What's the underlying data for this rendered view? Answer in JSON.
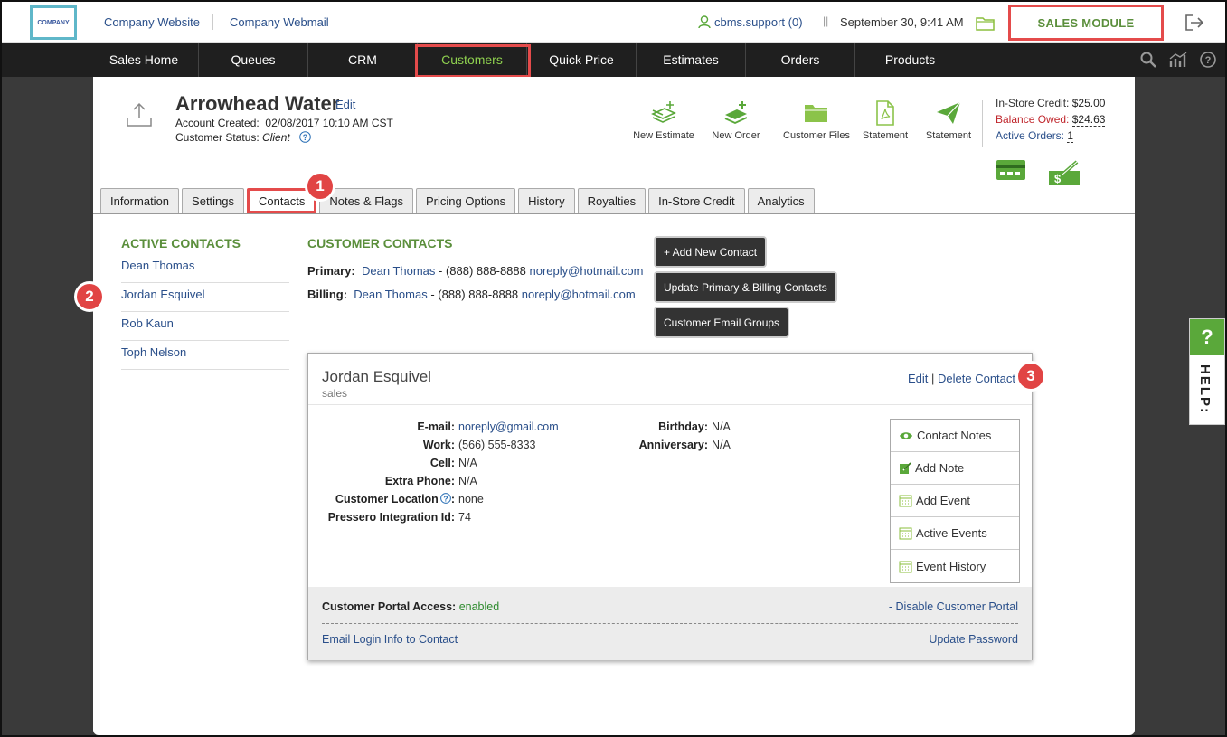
{
  "topbar": {
    "logo_text": "COMPANY",
    "company_website": "Company Website",
    "company_webmail": "Company Webmail",
    "user": "cbms.support (0)",
    "pipes": "||",
    "date": "September 30, 9:41 AM",
    "module": "SALES MODULE"
  },
  "nav": {
    "items": [
      "Sales Home",
      "Queues",
      "CRM",
      "Customers",
      "Quick Price",
      "Estimates",
      "Orders",
      "Products"
    ],
    "active": "Customers"
  },
  "customer": {
    "name": "Arrowhead Water",
    "edit": "Edit",
    "created_label": "Account Created:",
    "created_value": "02/08/2017 10:10 AM CST",
    "status_label": "Customer Status:",
    "status_value": "Client"
  },
  "quick_actions": [
    "New Estimate",
    "New Order",
    "Customer Files",
    "Statement",
    "Statement"
  ],
  "credit": {
    "instore_label": "In-Store Credit:",
    "instore_value": "$25.00",
    "owed_label": "Balance Owed:",
    "owed_value": "$24.63",
    "orders_label": "Active Orders:",
    "orders_value": "1"
  },
  "tabs": [
    "Information",
    "Settings",
    "Contacts",
    "Notes & Flags",
    "Pricing Options",
    "History",
    "Royalties",
    "In-Store Credit",
    "Analytics"
  ],
  "active_tab": "Contacts",
  "badges": [
    "1",
    "2",
    "3"
  ],
  "active_contacts": {
    "title": "ACTIVE CONTACTS",
    "items": [
      "Dean Thomas",
      "Jordan Esquivel",
      "Rob Kaun",
      "Toph Nelson"
    ]
  },
  "customer_contacts": {
    "title": "CUSTOMER CONTACTS",
    "primary_label": "Primary:",
    "primary_name": "Dean Thomas",
    "primary_phone": " - (888) 888-8888 ",
    "primary_email": "noreply@hotmail.com",
    "billing_label": "Billing:",
    "billing_name": "Dean Thomas",
    "billing_phone": " - (888) 888-8888 ",
    "billing_email": "noreply@hotmail.com"
  },
  "buttons": {
    "add_contact": "+ Add New Contact",
    "update_primary": "Update Primary & Billing Contacts",
    "email_groups": "Customer Email Groups"
  },
  "contact_card": {
    "name": "Jordan Esquivel",
    "title": "sales",
    "edit": "Edit",
    "sep": " | ",
    "delete": "Delete Contact",
    "fields": [
      {
        "label": "E-mail:",
        "value": "noreply@gmail.com"
      },
      {
        "label": "Work:",
        "value": "(566) 555-8333"
      },
      {
        "label": "Cell:",
        "value": "N/A"
      },
      {
        "label": "Extra Phone:",
        "value": "N/A"
      },
      {
        "label": "Customer Location",
        "value": "none"
      },
      {
        "label": "Pressero Integration Id:",
        "value": "74"
      }
    ],
    "fields2": [
      {
        "label": "Birthday:",
        "value": "N/A"
      },
      {
        "label": "Anniversary:",
        "value": "N/A"
      }
    ],
    "menu": [
      "Contact Notes",
      "Add Note",
      "Add Event",
      "Active Events",
      "Event History"
    ],
    "portal_label": "Customer Portal Access:",
    "portal_value": "enabled",
    "disable_portal": "- Disable Customer Portal",
    "email_login": "Email Login Info to Contact",
    "update_password": "Update Password"
  },
  "help": {
    "q": "?",
    "label": "HELP:"
  },
  "colors": {
    "accent_green": "#5b8f3c",
    "highlight_red": "#e44b4b",
    "link_blue": "#2a4f8a",
    "nav_bg": "#1f1f1f"
  }
}
